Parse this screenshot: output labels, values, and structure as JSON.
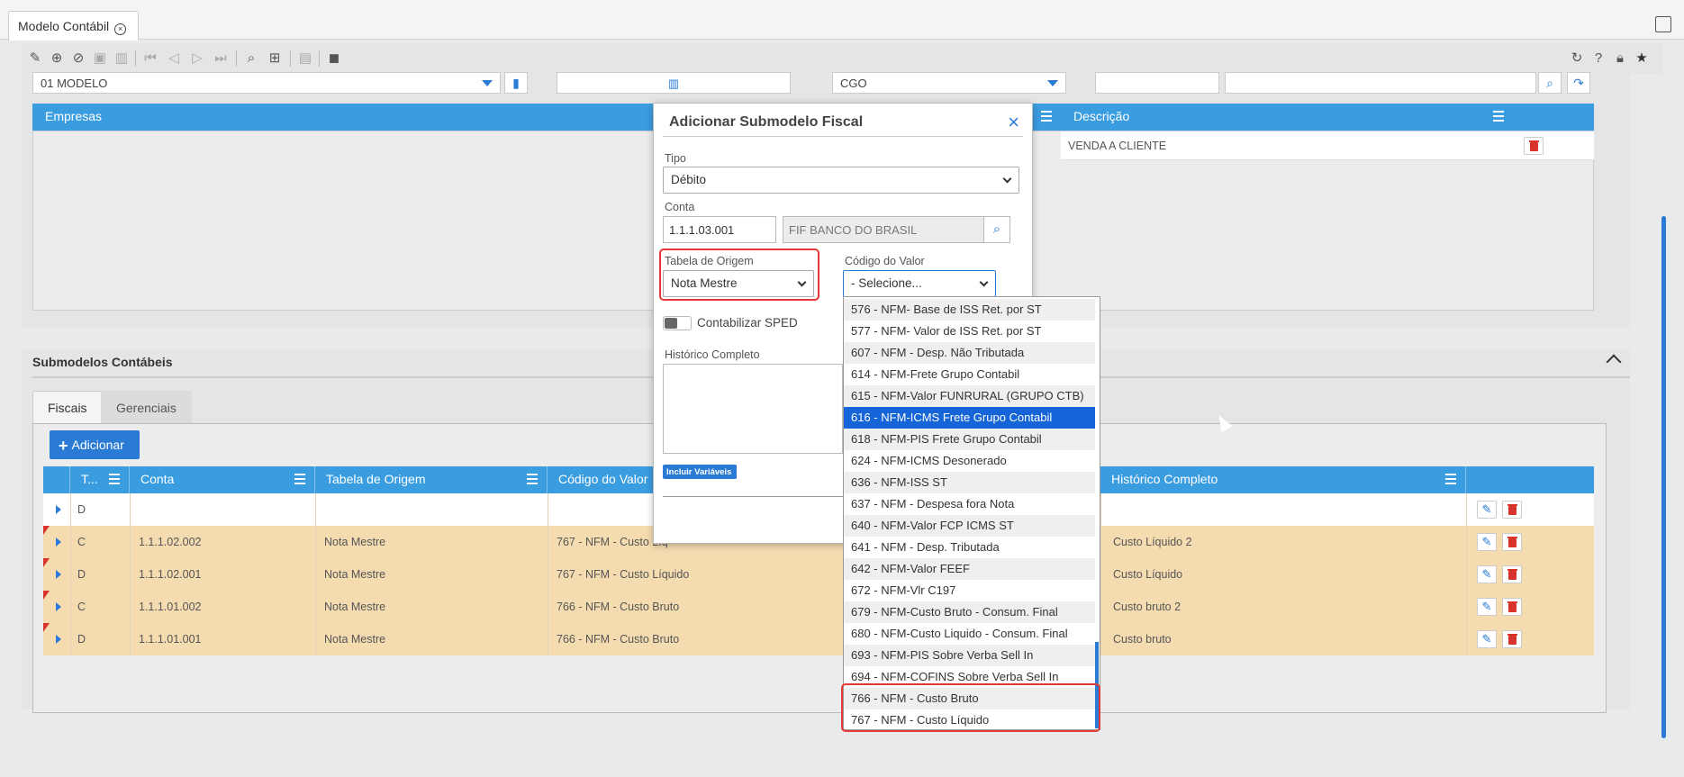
{
  "tab": {
    "title": "Modelo Contábil",
    "close": "×"
  },
  "toolbar": {
    "icons": [
      "broom-icon",
      "add-icon",
      "cancel-icon",
      "save-icon",
      "trash-icon",
      "first-icon",
      "prev-icon",
      "next-icon",
      "last-icon",
      "search-icon",
      "grid-icon",
      "copy-icon",
      "layers-icon"
    ],
    "right_icons": [
      "refresh-icon",
      "help-icon",
      "lock-icon",
      "star-icon"
    ]
  },
  "filters": {
    "modelo": "01 MODELO",
    "field2": "",
    "cgo": "CGO",
    "field4": "",
    "field5": ""
  },
  "empresas_grid": {
    "head1": "Empresas",
    "head2": "Descrição",
    "row_desc": "VENDA A CLIENTE"
  },
  "submodelos": {
    "title": "Submodelos Contábeis",
    "tabs": [
      "Fiscais",
      "Gerenciais"
    ],
    "add_label": "Adicionar",
    "columns": [
      "T...",
      "Conta",
      "Tabela de Origem",
      "Código do Valor",
      "Histórico Completo"
    ],
    "rows": [
      {
        "tipo": "D",
        "conta": "",
        "tabela": "",
        "codigo": "",
        "historico": "",
        "flag": false
      },
      {
        "tipo": "C",
        "conta": "1.1.1.02.002",
        "tabela": "Nota Mestre",
        "codigo": "767 - NFM - Custo Líq",
        "historico": "Custo Líquido 2",
        "flag": true
      },
      {
        "tipo": "D",
        "conta": "1.1.1.02.001",
        "tabela": "Nota Mestre",
        "codigo": "767 - NFM - Custo Líquido",
        "historico": "Custo Líquido",
        "flag": true
      },
      {
        "tipo": "C",
        "conta": "1.1.1.01.002",
        "tabela": "Nota Mestre",
        "codigo": "766 - NFM - Custo Bruto",
        "historico": "Custo bruto 2",
        "flag": true
      },
      {
        "tipo": "D",
        "conta": "1.1.1.01.001",
        "tabela": "Nota Mestre",
        "codigo": "766 - NFM - Custo Bruto",
        "historico": "Custo bruto",
        "flag": true
      }
    ]
  },
  "modal": {
    "title": "Adicionar Submodelo Fiscal",
    "close": "×",
    "tipo_label": "Tipo",
    "tipo_value": "Débito",
    "conta_label": "Conta",
    "conta_value": "1.1.1.03.001",
    "conta_desc": "FIF BANCO DO BRASIL",
    "tabela_label": "Tabela de Origem",
    "tabela_value": "Nota Mestre",
    "codigo_label": "Código do Valor",
    "codigo_value": "- Selecione...",
    "sped_label": "Contabilizar SPED",
    "hist_label": "Histórico Completo",
    "incl_label": "Incluir Variáveis"
  },
  "dropdown": {
    "options": [
      "576 - NFM- Base de ISS Ret. por ST",
      "577 - NFM- Valor de ISS Ret. por ST",
      "607 - NFM - Desp. Não Tributada",
      "614 - NFM-Frete Grupo Contabil",
      "615 - NFM-Valor FUNRURAL (GRUPO CTB)",
      "616 - NFM-ICMS Frete Grupo Contabil",
      "618 - NFM-PIS Frete Grupo Contabil",
      "624 - NFM-ICMS Desonerado",
      "636 - NFM-ISS ST",
      "637 - NFM - Despesa fora Nota",
      "640 - NFM-Valor FCP ICMS ST",
      "641 - NFM - Desp. Tributada",
      "642 - NFM-Valor FEEF",
      "672 - NFM-Vlr C197",
      "679 - NFM-Custo Bruto - Consum. Final",
      "680 - NFM-Custo Liquido - Consum. Final",
      "693 - NFM-PIS Sobre Verba Sell In",
      "694 - NFM-COFINS Sobre Verba Sell In",
      "766 - NFM - Custo Bruto",
      "767 - NFM - Custo Líquido"
    ],
    "selected": "616 - NFM-ICMS Frete Grupo Contabil"
  }
}
